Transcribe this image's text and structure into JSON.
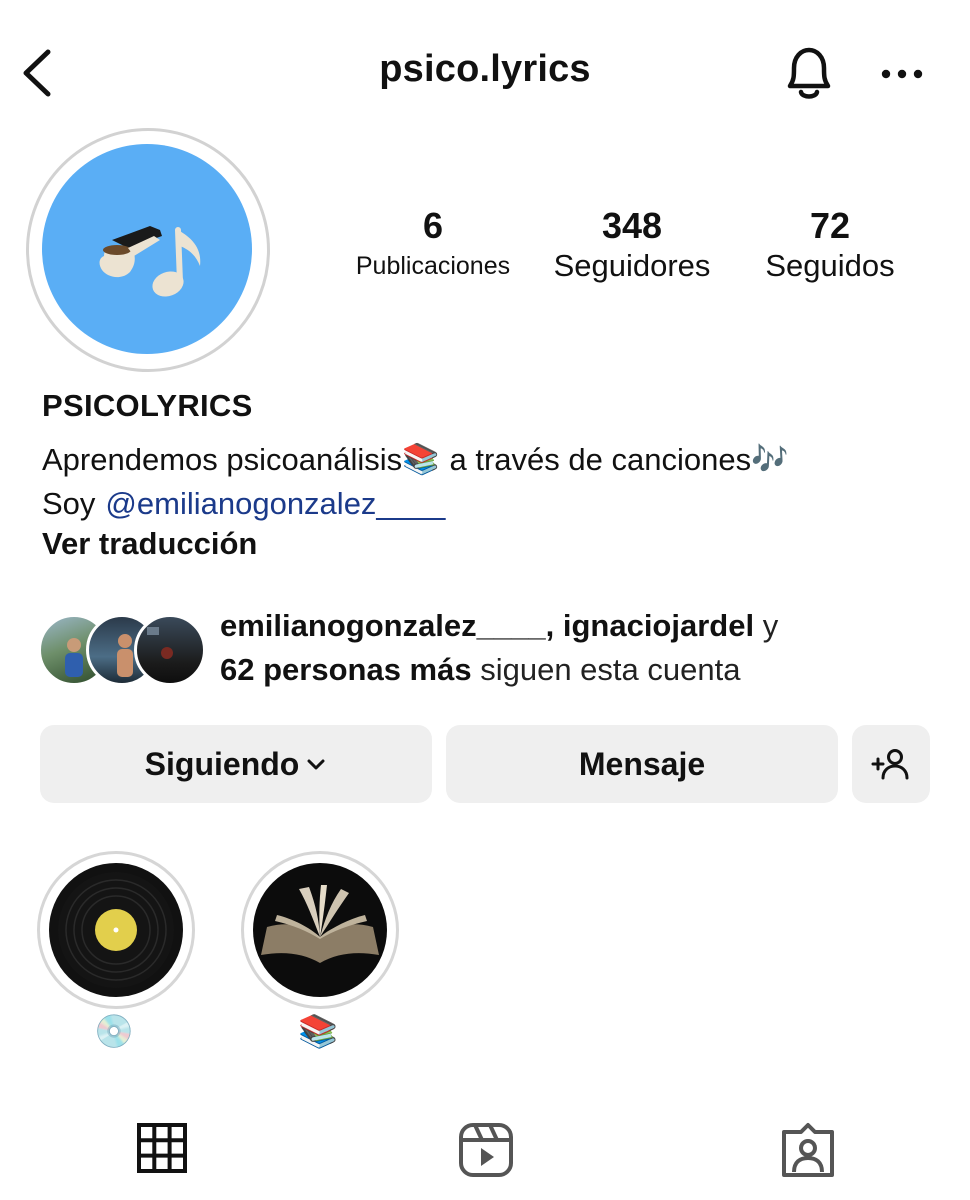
{
  "header": {
    "title": "psico.lyrics"
  },
  "profile": {
    "posts_count": "6",
    "posts_label": "Publicaciones",
    "followers_count": "348",
    "followers_label": "Seguidores",
    "following_count": "72",
    "following_label": "Seguidos",
    "display_name": "PSICOLYRICS",
    "bio_line1": "Aprendemos psicoanálisis",
    "bio_line1_emoji": "📚",
    "bio_line1_rest": "a través de canciones",
    "bio_line1_emoji2": "🎶",
    "bio_line2_prefix": "Soy",
    "bio_mention": "@emilianogonzalez____",
    "translate_label": "Ver traducción"
  },
  "followed_by": {
    "users": "emilianogonzalez____, ignaciojardel",
    "connector": "y",
    "others": "62 personas más",
    "suffix": "siguen esta cuenta"
  },
  "actions": {
    "following_label": "Siguiendo",
    "message_label": "Mensaje"
  },
  "highlights": [
    {
      "label": "💿"
    },
    {
      "label": "📚"
    }
  ],
  "tabs": [
    "grid-icon",
    "reels-icon",
    "tagged-icon"
  ],
  "colors": {
    "avatar_bg": "#5aaef5",
    "mention": "#1b3a8a",
    "button_bg": "#efefef"
  }
}
